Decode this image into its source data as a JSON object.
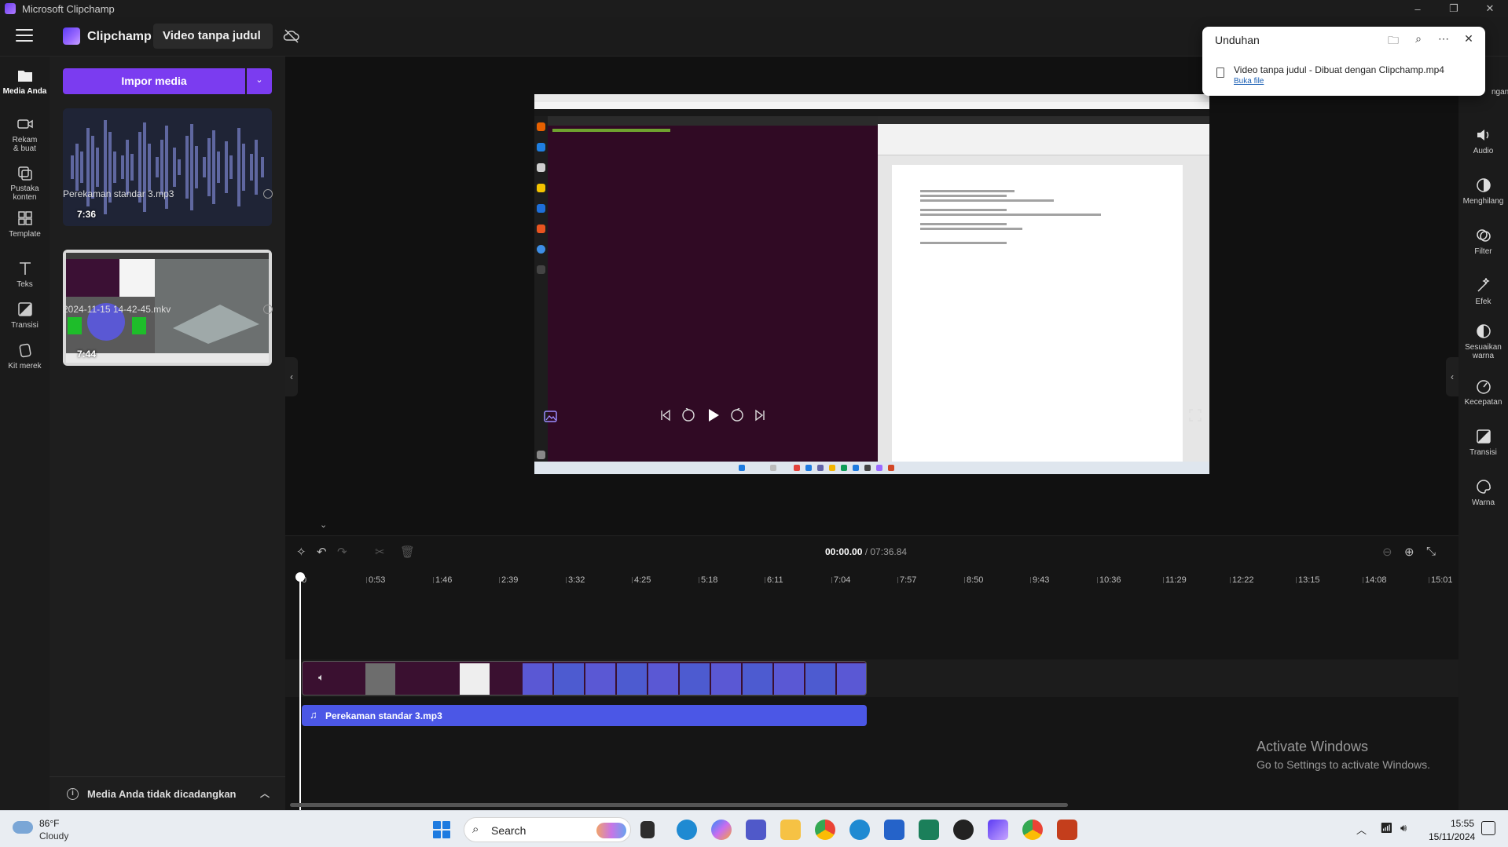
{
  "window": {
    "title": "Microsoft Clipchamp",
    "controls": [
      "–",
      "❐",
      "✕"
    ]
  },
  "header": {
    "brand": "Clipchamp",
    "project_title": "Video tanpa judul"
  },
  "left_nav": [
    {
      "label": "Media Anda",
      "icon": "folder-icon"
    },
    {
      "label": "Rekam & buat",
      "icon": "camera-icon"
    },
    {
      "label": "Pustaka konten",
      "icon": "library-icon"
    },
    {
      "label": "Template",
      "icon": "template-icon"
    },
    {
      "label": "Teks",
      "icon": "text-icon"
    },
    {
      "label": "Transisi",
      "icon": "transition-icon"
    },
    {
      "label": "Kit merek",
      "icon": "brand-kit-icon"
    }
  ],
  "media": {
    "import_label": "Impor media",
    "items": [
      {
        "name": "Perekaman standar 3.mp3",
        "duration": "7:36"
      },
      {
        "name": "2024-11-15 14-42-45.mkv",
        "duration": "7:44"
      }
    ],
    "backup_notice": "Media Anda tidak dicadangkan"
  },
  "right_nav": [
    {
      "label": "Audio",
      "icon": "audio-icon"
    },
    {
      "label": "Menghilang",
      "icon": "fade-icon"
    },
    {
      "label": "Filter",
      "icon": "filter-icon"
    },
    {
      "label": "Efek",
      "icon": "effects-icon"
    },
    {
      "label": "Sesuaikan warna",
      "icon": "adjust-color-icon"
    },
    {
      "label": "Kecepatan",
      "icon": "speed-icon"
    },
    {
      "label": "Transisi",
      "icon": "transition-icon"
    },
    {
      "label": "Warna",
      "icon": "color-icon"
    }
  ],
  "right_nav_partial": "ngan",
  "download": {
    "title": "Unduhan",
    "file": "Video tanpa judul - Dibuat dengan Clipchamp.mp4",
    "open_link": "Buka file"
  },
  "timeline": {
    "current_time": "00:00.00",
    "total_time": "/ 07:36.84",
    "ticks": [
      "0",
      "0:53",
      "1:46",
      "2:39",
      "3:32",
      "4:25",
      "5:18",
      "6:11",
      "7:04",
      "7:57",
      "8:50",
      "9:43",
      "10:36",
      "11:29",
      "12:22",
      "13:15",
      "14:08",
      "15:01"
    ],
    "audio_clip": "Perekaman standar 3.mp3"
  },
  "watermark": {
    "line1": "Activate Windows",
    "line2": "Go to Settings to activate Windows."
  },
  "taskbar": {
    "weather_temp": "86°F",
    "weather_cond": "Cloudy",
    "search": "Search",
    "time": "15:55",
    "date": "15/11/2024"
  },
  "colors": {
    "accent": "#7b3cf0",
    "audio_clip": "#4b57e6",
    "terminal_bg": "#300a24"
  }
}
